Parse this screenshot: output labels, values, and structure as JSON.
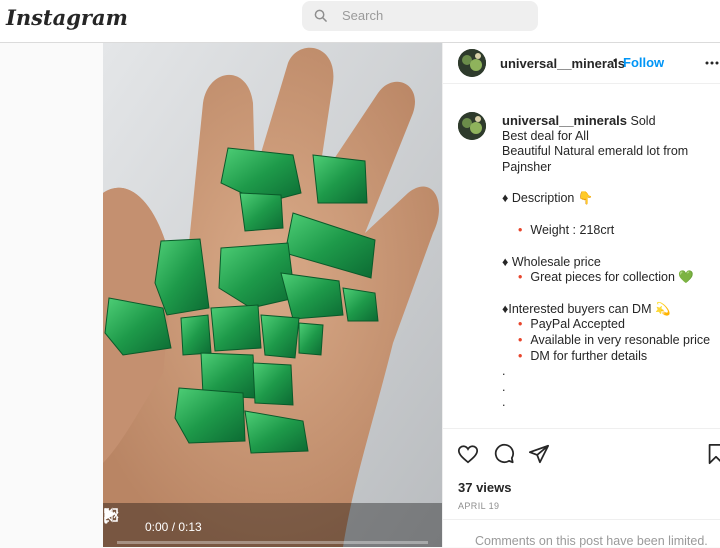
{
  "app": {
    "logo": "Instagram"
  },
  "search": {
    "placeholder": "Search"
  },
  "video": {
    "time": "0:00 / 0:13",
    "progress": 0.0
  },
  "post": {
    "username": "universal__minerals",
    "separator": "•",
    "follow_label": "Follow",
    "caption": {
      "username": "universal__minerals",
      "first": "Sold",
      "lines": [
        "Best deal for All",
        "Beautiful Natural emerald lot from",
        "Pajnsher"
      ],
      "description": "♦ Description 👇",
      "weight": "Weight : 218crt",
      "wholesale": "♦ Wholesale price",
      "great": "Great pieces for collection 💚",
      "interested": "♦Interested buyers can DM 💫",
      "bullets": [
        "PayPal Accepted",
        "Available in very resonable price",
        "DM for further details"
      ],
      "dots": [
        ".",
        ".",
        "."
      ]
    },
    "views": "37 views",
    "date": "APRIL 19",
    "comments_limited": "Comments on this post have been limited."
  },
  "colors": {
    "accent": "#0095f6",
    "bullet": "#e8452c",
    "emerald": "#1f9a4c"
  }
}
